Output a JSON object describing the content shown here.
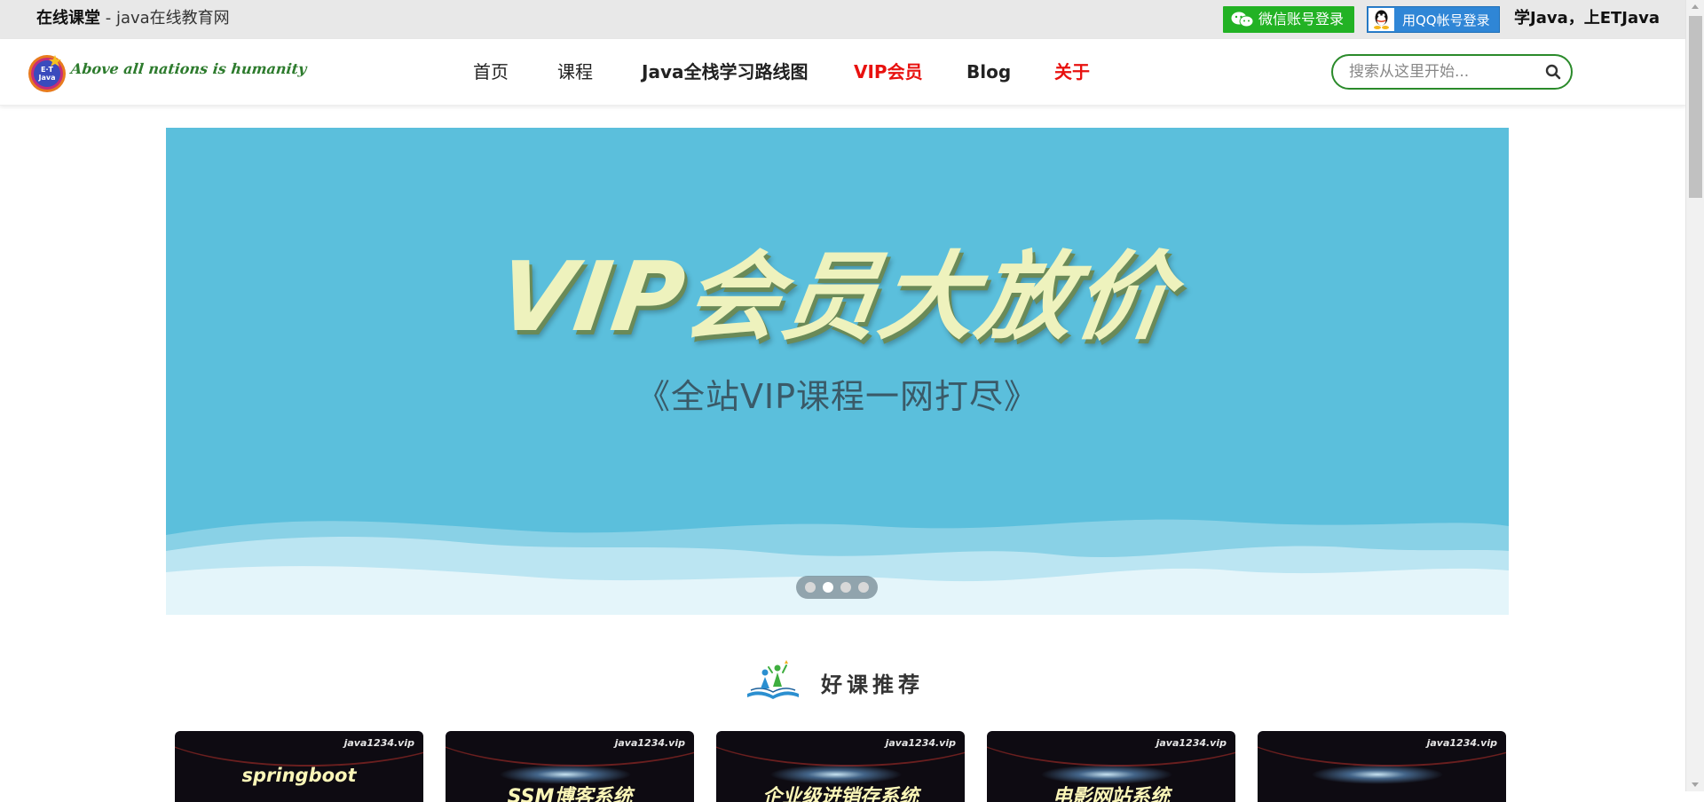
{
  "topbar": {
    "site_name": "在线课堂",
    "site_desc": " - java在线教育网",
    "wechat_login": "微信账号登录",
    "qq_login": "用QQ帐号登录",
    "slogan": "学Java，上ETJava"
  },
  "logo": {
    "badge_text": "E·T Java",
    "tagline": "Above all nations is humanity"
  },
  "nav": {
    "items": [
      "首页",
      "课程",
      "Java全栈学习路线图",
      "VIP会员",
      "Blog",
      "关于"
    ]
  },
  "search": {
    "placeholder": "搜索从这里开始...",
    "icon": "search-icon"
  },
  "banner": {
    "headline": "VIP会员大放价",
    "subtitle": "《全站VIP课程一网打尽》",
    "slide_count": 4,
    "active_slide": 2
  },
  "section": {
    "title": "好课推荐"
  },
  "courses": [
    {
      "site": "java1234.vip",
      "title": "springboot"
    },
    {
      "site": "java1234.vip",
      "title": "SSM博客系统"
    },
    {
      "site": "java1234.vip",
      "title": "企业级进销存系统"
    },
    {
      "site": "java1234.vip",
      "title": "电影网站系统"
    },
    {
      "site": "java1234.vip",
      "title": ""
    }
  ],
  "colors": {
    "wechat_green": "#22b224",
    "qq_blue": "#2f86d6",
    "nav_red": "#e8110f",
    "search_border": "#2a8a2a",
    "banner_bg": "#5bbfdc",
    "headline": "#eef2bd"
  }
}
